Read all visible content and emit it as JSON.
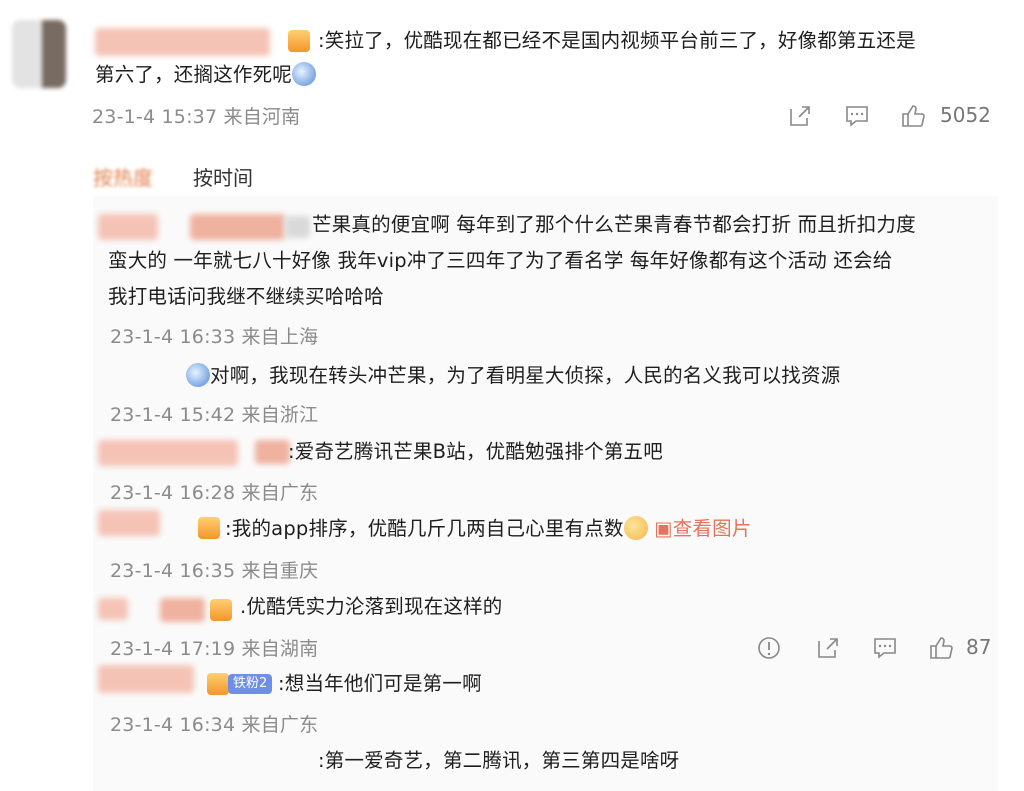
{
  "main_comment": {
    "text_line1": ":笑拉了，优酷现在都已经不是国内视频平台前三了，好像都第五还是",
    "text_line2": "第六了，还搁这作死呢",
    "meta": "23-1-4 15:37 来自河南",
    "like_count": "5052"
  },
  "tabs": {
    "hot": "按热度",
    "time": "按时间"
  },
  "replies": [
    {
      "line1": "芒果真的便宜啊 每年到了那个什么芒果青春节都会打折 而且折扣力度",
      "line2": "蛮大的 一年就七八十好像 我年vip冲了三四年了为了看名学 每年好像都有这个活动  还会给",
      "line3": "我打电话问我继不继续买哈哈哈",
      "meta": "23-1-4 16:33 来自上海"
    },
    {
      "text": "对啊，我现在转头冲芒果，为了看明星大侦探，人民的名义我可以找资源",
      "meta": "23-1-4 15:42 来自浙江"
    },
    {
      "text": ":爱奇艺腾讯芒果B站，优酷勉强排个第五吧",
      "meta": "23-1-4 16:28 来自广东"
    },
    {
      "text": ":我的app排序，优酷几斤几两自己心里有点数",
      "link": "查看图片",
      "meta": "23-1-4 16:35 来自重庆"
    },
    {
      "text": ".优酷凭实力沦落到现在这样的",
      "meta": "23-1-4 17:19 来自湖南",
      "like_count": "87"
    },
    {
      "badge": "铁粉2",
      "text": ":想当年他们可是第一啊",
      "meta": "23-1-4 16:34 来自广东"
    },
    {
      "text": ":第一爱奇艺，第二腾讯，第三第四是啥呀"
    }
  ],
  "icons": [
    "share-icon",
    "comment-icon",
    "like-icon",
    "report-icon",
    "picture-icon"
  ],
  "colors": {
    "accent": "#e8735d",
    "meta_grey": "#8b8b8b",
    "vip_badge": "#6f8fe6"
  }
}
